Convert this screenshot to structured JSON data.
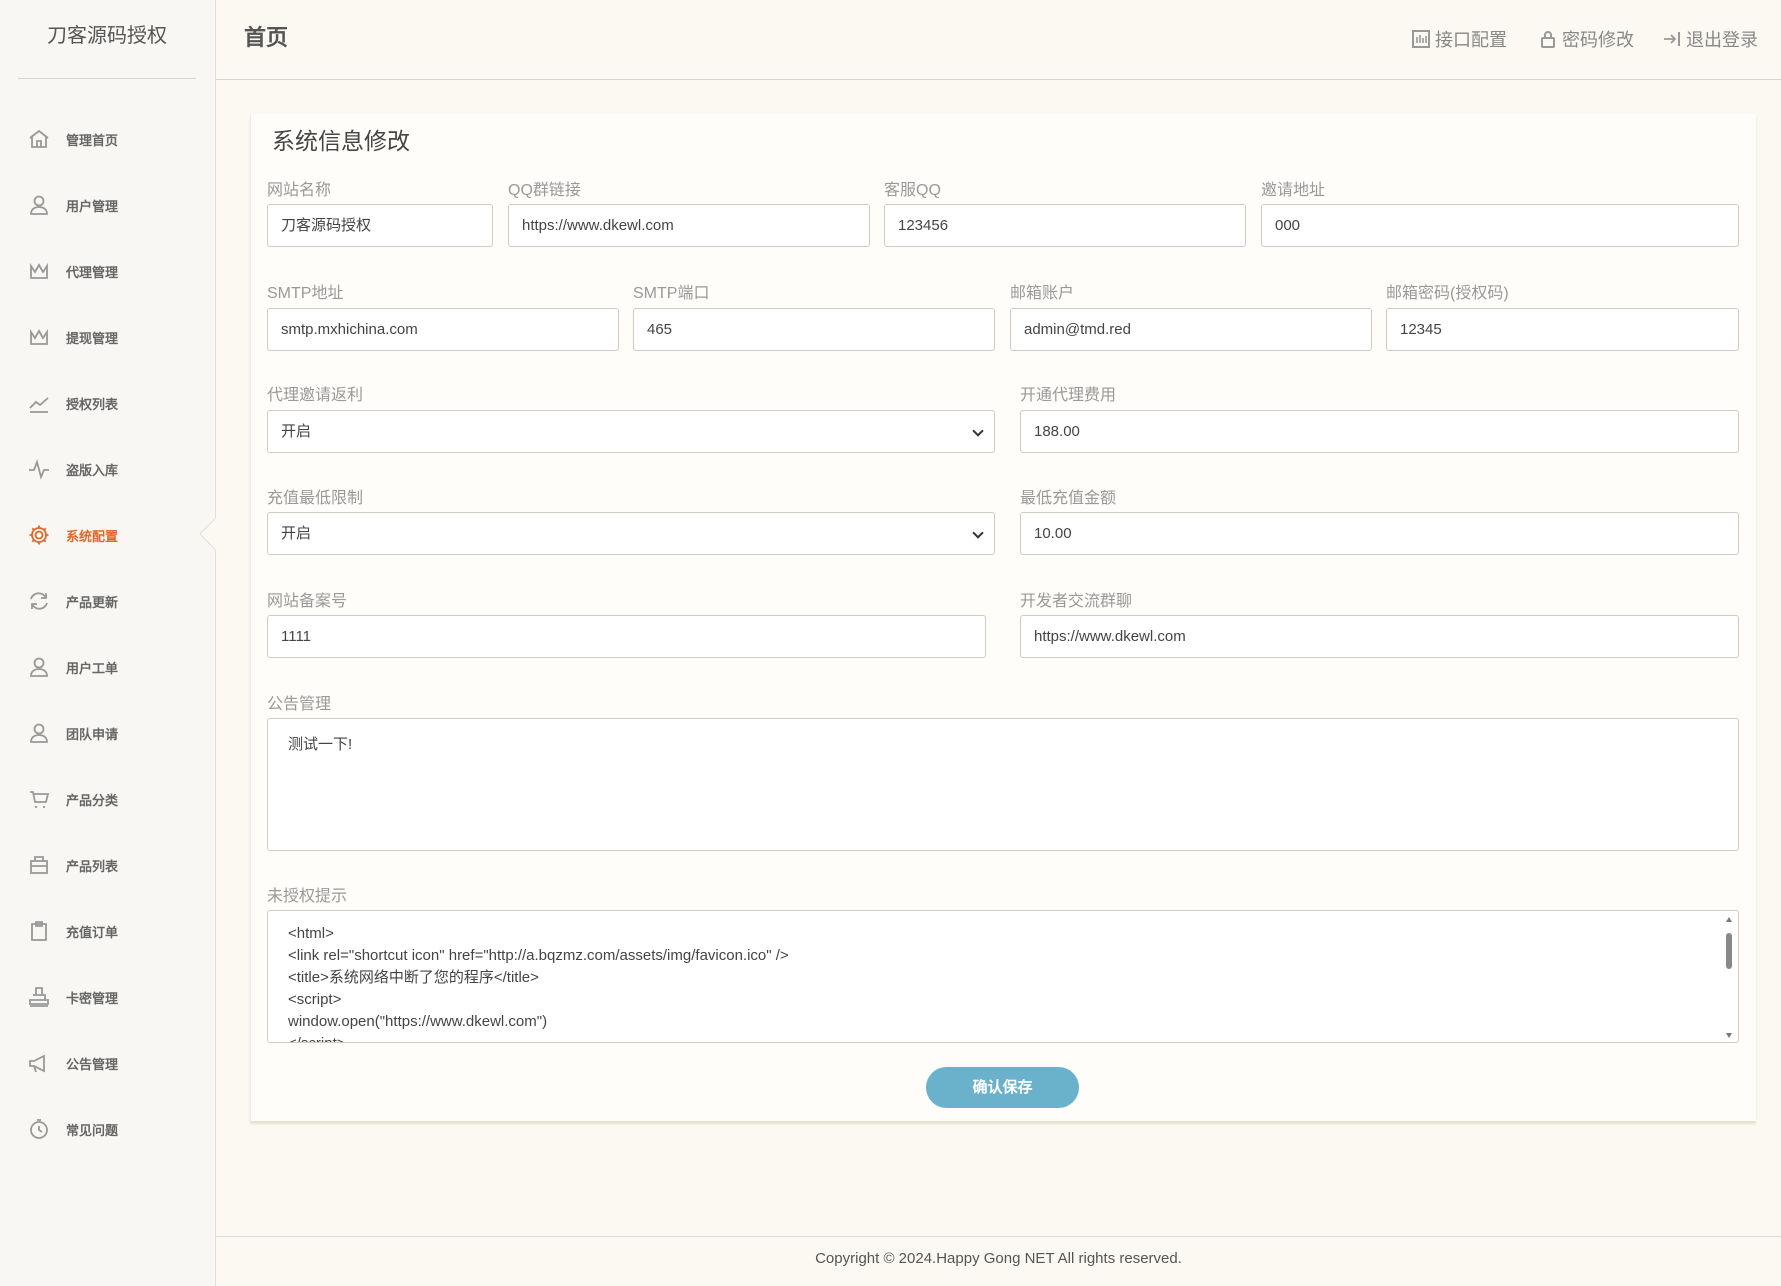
{
  "sidebar": {
    "logo": "刀客源码授权",
    "active_color": "#e0682d",
    "items": [
      {
        "label": "管理首页",
        "icon": "home-icon"
      },
      {
        "label": "用户管理",
        "icon": "user-icon"
      },
      {
        "label": "代理管理",
        "icon": "crown-icon"
      },
      {
        "label": "提现管理",
        "icon": "crown-icon"
      },
      {
        "label": "授权列表",
        "icon": "trend-icon"
      },
      {
        "label": "盗版入库",
        "icon": "pulse-icon"
      },
      {
        "label": "系统配置",
        "icon": "gear-icon",
        "active": true
      },
      {
        "label": "产品更新",
        "icon": "refresh-icon"
      },
      {
        "label": "用户工单",
        "icon": "user-icon"
      },
      {
        "label": "团队申请",
        "icon": "user-icon"
      },
      {
        "label": "产品分类",
        "icon": "cart-icon"
      },
      {
        "label": "产品列表",
        "icon": "box-icon"
      },
      {
        "label": "充值订单",
        "icon": "clipboard-icon"
      },
      {
        "label": "卡密管理",
        "icon": "stamp-icon"
      },
      {
        "label": "公告管理",
        "icon": "megaphone-icon"
      },
      {
        "label": "常见问题",
        "icon": "timer-icon"
      }
    ]
  },
  "header": {
    "title": "首页",
    "links": [
      {
        "label": "接口配置",
        "icon": "chart-icon"
      },
      {
        "label": "密码修改",
        "icon": "lock-icon"
      },
      {
        "label": "退出登录",
        "icon": "logout-icon"
      }
    ]
  },
  "form": {
    "title": "系统信息修改",
    "site_name": {
      "label": "网站名称",
      "value": "刀客源码授权"
    },
    "qq_group": {
      "label": "QQ群链接",
      "value": "https://www.dkewl.com"
    },
    "service_qq": {
      "label": "客服QQ",
      "value": "123456"
    },
    "invite_url": {
      "label": "邀请地址",
      "value": "000"
    },
    "smtp_host": {
      "label": "SMTP地址",
      "value": "smtp.mxhichina.com"
    },
    "smtp_port": {
      "label": "SMTP端口",
      "value": "465"
    },
    "mail_account": {
      "label": "邮箱账户",
      "value": "admin@tmd.red"
    },
    "mail_password": {
      "label": "邮箱密码(授权码)",
      "value": "12345"
    },
    "agent_rebate": {
      "label": "代理邀请返利",
      "value": "开启"
    },
    "agent_fee": {
      "label": "开通代理费用",
      "value": "188.00"
    },
    "recharge_limit": {
      "label": "充值最低限制",
      "value": "开启"
    },
    "min_recharge": {
      "label": "最低充值金额",
      "value": "10.00"
    },
    "icp": {
      "label": "网站备案号",
      "value": "1111"
    },
    "dev_group": {
      "label": "开发者交流群聊",
      "value": "https://www.dkewl.com"
    },
    "notice": {
      "label": "公告管理",
      "value": "测试一下!"
    },
    "unauth": {
      "label": "未授权提示",
      "lines": [
        "<html>",
        "<link rel=\"shortcut icon\" href=\"http://a.bqzmz.com/assets/img/favicon.ico\" />",
        "<title>系统网络中断了您的程序</title>",
        "<script>",
        "window.open(\"https://www.dkewl.com\")",
        "</script>"
      ]
    },
    "save_label": "确认保存"
  },
  "footer": {
    "copyright": "Copyright © 2024.Happy Gong NET All rights reserved."
  }
}
